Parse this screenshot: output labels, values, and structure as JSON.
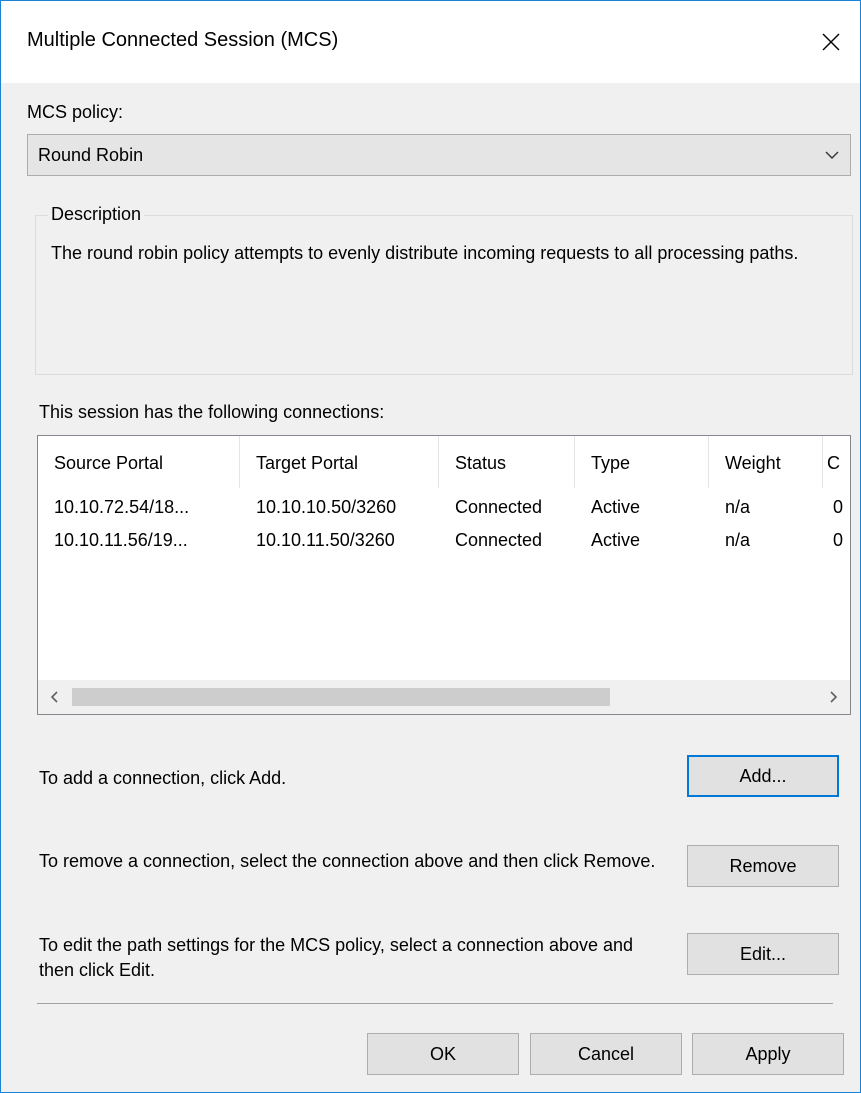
{
  "window": {
    "title": "Multiple Connected Session (MCS)"
  },
  "policy": {
    "label": "MCS policy:",
    "selected": "Round Robin"
  },
  "description": {
    "legend": "Description",
    "text": "The round robin policy attempts to evenly distribute incoming requests to all processing paths."
  },
  "connections": {
    "label": "This session has the following connections:",
    "columns": [
      "Source Portal",
      "Target Portal",
      "Status",
      "Type",
      "Weight",
      "C"
    ],
    "rows": [
      [
        "10.10.72.54/18...",
        "10.10.10.50/3260",
        "Connected",
        "Active",
        "n/a",
        "0"
      ],
      [
        "10.10.11.56/19...",
        "10.10.11.50/3260",
        "Connected",
        "Active",
        "n/a",
        "0"
      ]
    ]
  },
  "actions": {
    "add_text": "To add a connection, click Add.",
    "add_label": "Add...",
    "remove_text": "To remove a connection, select the connection above and then click Remove.",
    "remove_label": "Remove",
    "edit_text": "To edit the path settings for the MCS policy, select a connection above and then click Edit.",
    "edit_label": "Edit..."
  },
  "footer": {
    "ok_label": "OK",
    "cancel_label": "Cancel",
    "apply_label": "Apply"
  },
  "icons": {
    "close": "close-icon",
    "dropdown": "chevron-down-icon",
    "scroll_left": "chevron-left-icon",
    "scroll_right": "chevron-right-icon"
  },
  "colors": {
    "accent": "#0078d7",
    "dialog_bg": "#f0f0f0",
    "window_border": "#1883d7"
  }
}
